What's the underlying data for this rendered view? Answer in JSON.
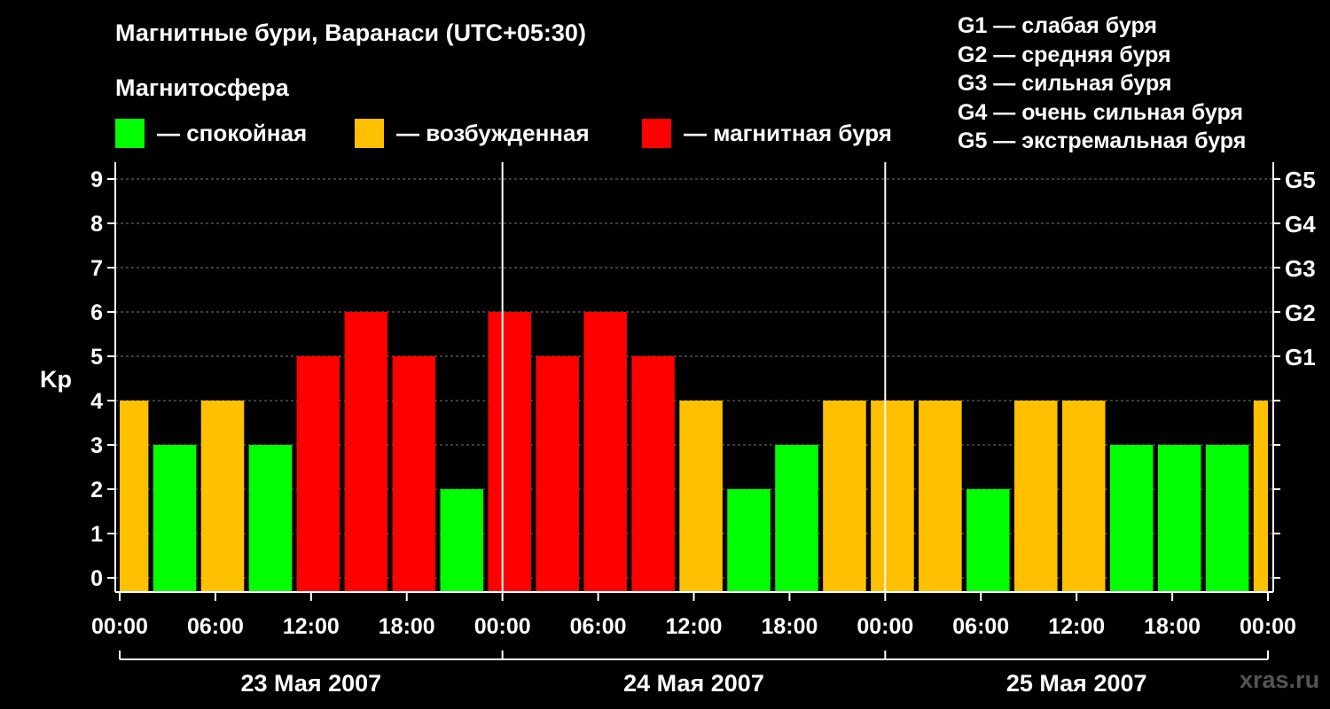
{
  "header": {
    "title": "Магнитные бури, Варанаси (UTC+05:30)",
    "subtitle": "Магнитосфера"
  },
  "legend": {
    "items": [
      {
        "label": "— спокойная",
        "color": "#00ff00"
      },
      {
        "label": "— возбужденная",
        "color": "#ffc000"
      },
      {
        "label": "— магнитная буря",
        "color": "#ff0000"
      }
    ]
  },
  "storm_scale": [
    "G1 — слабая буря",
    "G2 — средняя буря",
    "G3 — сильная буря",
    "G4 — очень сильная буря",
    "G5 — экстремальная буря"
  ],
  "watermark": "xras.ru",
  "chart_data": {
    "type": "bar",
    "ylabel": "Kp",
    "ylim": [
      0,
      9
    ],
    "yticks": [
      "0",
      "1",
      "2",
      "3",
      "4",
      "5",
      "6",
      "7",
      "8",
      "9"
    ],
    "right_ticks": [
      {
        "value": 5,
        "label": "G1"
      },
      {
        "value": 6,
        "label": "G2"
      },
      {
        "value": 7,
        "label": "G3"
      },
      {
        "value": 8,
        "label": "G4"
      },
      {
        "value": 9,
        "label": "G5"
      }
    ],
    "xlim_hours": [
      0,
      72
    ],
    "xtick_labels": [
      "00:00",
      "06:00",
      "12:00",
      "18:00",
      "00:00",
      "06:00",
      "12:00",
      "18:00",
      "00:00",
      "06:00",
      "12:00",
      "18:00",
      "00:00"
    ],
    "day_labels": [
      "23 Мая 2007",
      "24 Мая 2007",
      "25 Мая 2007"
    ],
    "bars": [
      {
        "start_hour": 0.0,
        "end_hour": 1.8,
        "value": 4,
        "color": "#ffc000"
      },
      {
        "start_hour": 2.1,
        "end_hour": 4.8,
        "value": 3,
        "color": "#00ff00"
      },
      {
        "start_hour": 5.1,
        "end_hour": 7.8,
        "value": 4,
        "color": "#ffc000"
      },
      {
        "start_hour": 8.1,
        "end_hour": 10.8,
        "value": 3,
        "color": "#00ff00"
      },
      {
        "start_hour": 11.1,
        "end_hour": 13.8,
        "value": 5,
        "color": "#ff0000"
      },
      {
        "start_hour": 14.1,
        "end_hour": 16.8,
        "value": 6,
        "color": "#ff0000"
      },
      {
        "start_hour": 17.1,
        "end_hour": 19.8,
        "value": 5,
        "color": "#ff0000"
      },
      {
        "start_hour": 20.1,
        "end_hour": 22.8,
        "value": 2,
        "color": "#00ff00"
      },
      {
        "start_hour": 23.1,
        "end_hour": 25.8,
        "value": 6,
        "color": "#ff0000"
      },
      {
        "start_hour": 26.1,
        "end_hour": 28.8,
        "value": 5,
        "color": "#ff0000"
      },
      {
        "start_hour": 29.1,
        "end_hour": 31.8,
        "value": 6,
        "color": "#ff0000"
      },
      {
        "start_hour": 32.1,
        "end_hour": 34.8,
        "value": 5,
        "color": "#ff0000"
      },
      {
        "start_hour": 35.1,
        "end_hour": 37.8,
        "value": 4,
        "color": "#ffc000"
      },
      {
        "start_hour": 38.1,
        "end_hour": 40.8,
        "value": 2,
        "color": "#00ff00"
      },
      {
        "start_hour": 41.1,
        "end_hour": 43.8,
        "value": 3,
        "color": "#00ff00"
      },
      {
        "start_hour": 44.1,
        "end_hour": 46.8,
        "value": 4,
        "color": "#ffc000"
      },
      {
        "start_hour": 47.1,
        "end_hour": 49.8,
        "value": 4,
        "color": "#ffc000"
      },
      {
        "start_hour": 50.1,
        "end_hour": 52.8,
        "value": 4,
        "color": "#ffc000"
      },
      {
        "start_hour": 53.1,
        "end_hour": 55.8,
        "value": 2,
        "color": "#00ff00"
      },
      {
        "start_hour": 56.1,
        "end_hour": 58.8,
        "value": 4,
        "color": "#ffc000"
      },
      {
        "start_hour": 59.1,
        "end_hour": 61.8,
        "value": 4,
        "color": "#ffc000"
      },
      {
        "start_hour": 62.1,
        "end_hour": 64.8,
        "value": 3,
        "color": "#00ff00"
      },
      {
        "start_hour": 65.1,
        "end_hour": 67.8,
        "value": 3,
        "color": "#00ff00"
      },
      {
        "start_hour": 68.1,
        "end_hour": 70.8,
        "value": 3,
        "color": "#00ff00"
      },
      {
        "start_hour": 71.1,
        "end_hour": 72.0,
        "value": 4,
        "color": "#ffc000"
      }
    ]
  }
}
